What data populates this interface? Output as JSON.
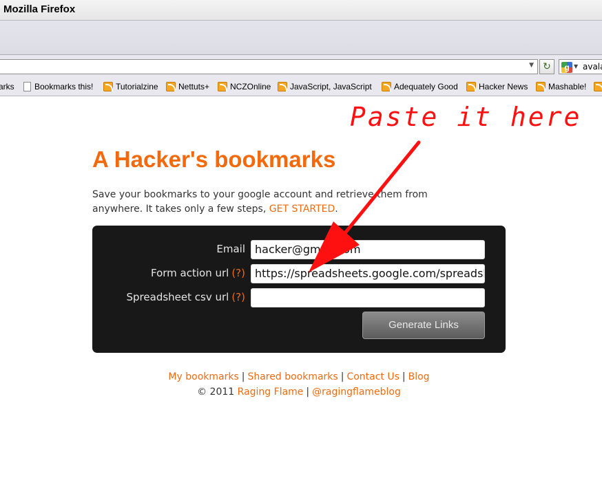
{
  "window": {
    "title": "Mozilla Firefox"
  },
  "navigation": {
    "url": "",
    "reload_icon": "reload-icon",
    "search_engine_icon": "google-icon",
    "search_text": "avala"
  },
  "bookmarks_toolbar": {
    "items": [
      {
        "label": "arks",
        "icon": "none"
      },
      {
        "label": "Bookmarks this!",
        "icon": "page-icon"
      },
      {
        "label": "Tutorialzine",
        "icon": "rss-icon"
      },
      {
        "label": "Nettuts+",
        "icon": "rss-icon"
      },
      {
        "label": "NCZOnline",
        "icon": "rss-icon"
      },
      {
        "label": "JavaScript, JavaScript",
        "icon": "rss-icon"
      },
      {
        "label": "Adequately Good",
        "icon": "rss-icon"
      },
      {
        "label": "Hacker News",
        "icon": "rss-icon"
      },
      {
        "label": "Mashable!",
        "icon": "rss-icon"
      }
    ]
  },
  "page": {
    "heading": "A Hacker's bookmarks",
    "intro_text": "Save your bookmarks to your google account and retrieve them from anywhere. It takes only a few steps, ",
    "intro_link": "GET STARTED",
    "intro_end": ".",
    "form": {
      "email_label": "Email",
      "email_value": "hacker@gmail.com",
      "form_action_label": "Form action url",
      "form_action_help": "(?)",
      "form_action_value": "https://spreadsheets.google.com/spreadsheet",
      "csv_label": "Spreadsheet csv url",
      "csv_help": "(?)",
      "csv_value": "",
      "generate_button": "Generate Links"
    },
    "footer": {
      "links": [
        "My bookmarks",
        "Shared bookmarks",
        "Contact Us",
        "Blog"
      ],
      "separator": "|",
      "copyright_prefix": "© 2011",
      "company_link": "Raging Flame",
      "twitter_link": "@ragingflameblog"
    }
  },
  "annotation": {
    "text": "Paste it here",
    "color": "#ff1010"
  },
  "colors": {
    "accent": "#f26a0d",
    "form_background": "#181818"
  }
}
